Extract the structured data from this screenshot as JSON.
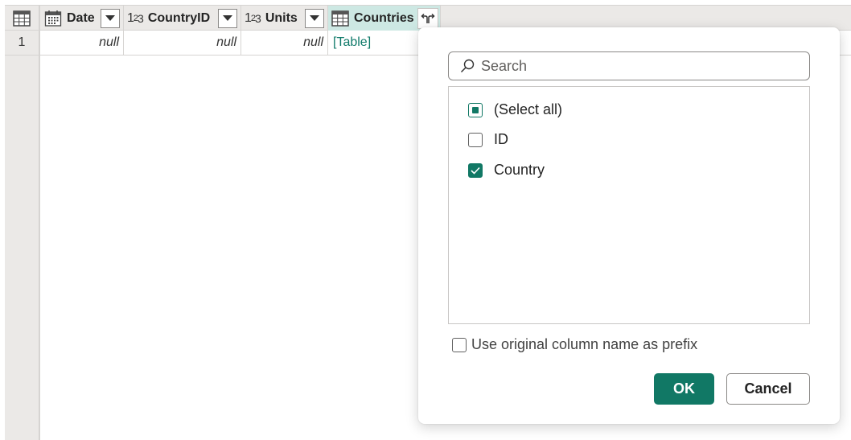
{
  "grid": {
    "columns": [
      {
        "name": "Date",
        "type_icon": "calendar-icon"
      },
      {
        "name": "CountryID",
        "type_icon": "whole-number-icon",
        "type_label": [
          "1",
          "2",
          "3"
        ]
      },
      {
        "name": "Units",
        "type_icon": "whole-number-icon",
        "type_label": [
          "1",
          "2",
          "3"
        ]
      },
      {
        "name": "Countries",
        "type_icon": "table-icon"
      }
    ],
    "rows": [
      {
        "row_number": "1",
        "cells": [
          "null",
          "null",
          "null",
          "[Table]"
        ]
      }
    ]
  },
  "expand_popup": {
    "search_placeholder": "Search",
    "items": [
      {
        "label": "(Select all)",
        "state": "mixed"
      },
      {
        "label": "ID",
        "state": "unchecked"
      },
      {
        "label": "Country",
        "state": "checked"
      }
    ],
    "prefix_label": "Use original column name as prefix",
    "prefix_checked": false,
    "ok_label": "OK",
    "cancel_label": "Cancel"
  },
  "colors": {
    "accent": "#117865",
    "selected_column_bg": "#cde8e3",
    "header_bg": "#ebe9e7"
  }
}
